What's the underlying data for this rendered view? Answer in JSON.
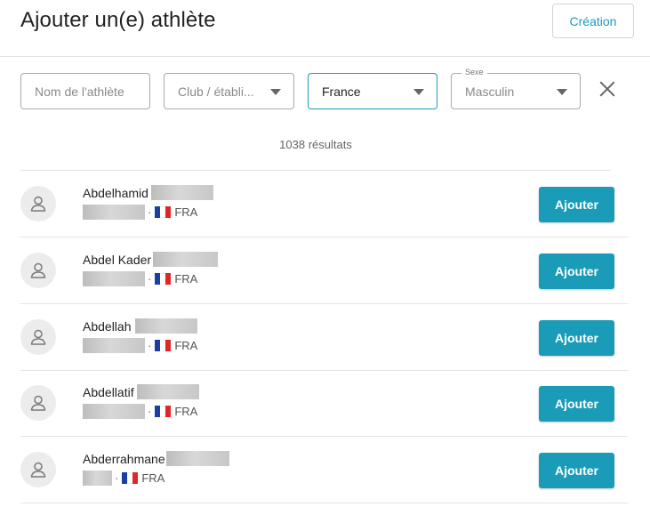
{
  "header": {
    "title": "Ajouter un(e) athlète",
    "creation_label": "Création"
  },
  "filters": {
    "name_placeholder": "Nom de l'athlète",
    "club_placeholder": "Club / établi...",
    "country_value": "France",
    "sex_label": "Sexe",
    "sex_value": "Masculin"
  },
  "results": {
    "count_label": "1038 résultats"
  },
  "athletes": [
    {
      "first_name": "Abdelhamid",
      "country_code": "FRA",
      "add_label": "Ajouter"
    },
    {
      "first_name": "Abdel Kader",
      "country_code": "FRA",
      "add_label": "Ajouter"
    },
    {
      "first_name": "Abdellah",
      "country_code": "FRA",
      "add_label": "Ajouter"
    },
    {
      "first_name": "Abdellatif",
      "country_code": "FRA",
      "add_label": "Ajouter"
    },
    {
      "first_name": "Abderrahmane",
      "country_code": "FRA",
      "add_label": "Ajouter"
    }
  ],
  "icons": {
    "avatar": "user-icon",
    "flag": "france-flag-icon",
    "clear": "close-icon",
    "dropdown": "caret-down-icon"
  },
  "colors": {
    "accent": "#1a9bb8",
    "border": "#a9a9a9",
    "divider": "#e3e3e3"
  }
}
